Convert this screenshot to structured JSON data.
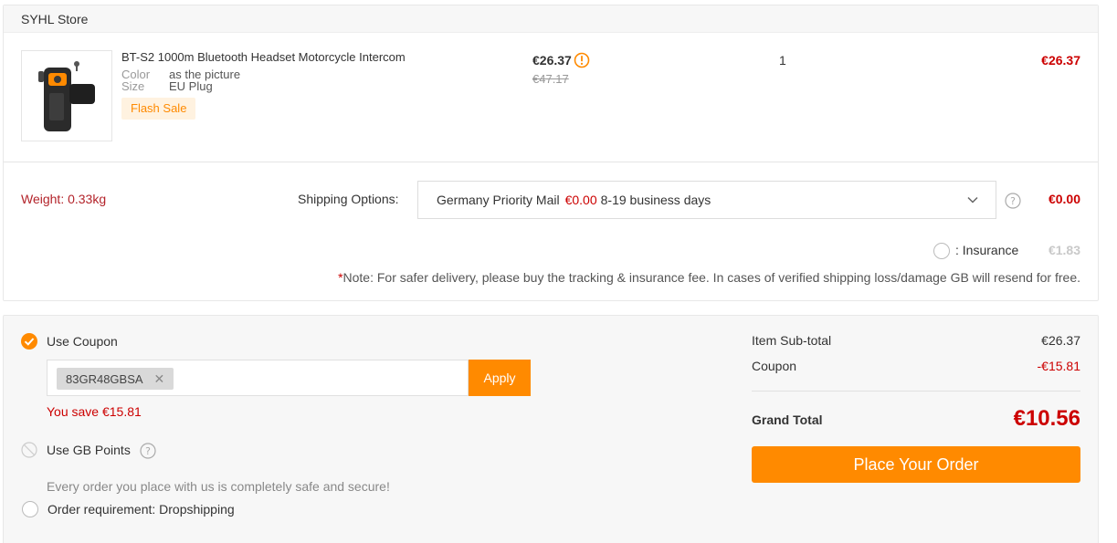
{
  "store": {
    "name": "SYHL Store"
  },
  "product": {
    "title": "BT-S2 1000m Bluetooth Headset Motorcycle Intercom",
    "color_label": "Color",
    "color_value": "as the picture",
    "size_label": "Size",
    "size_value": "EU Plug",
    "badge": "Flash Sale",
    "price": "€26.37",
    "original_price": "€47.17",
    "quantity": "1",
    "line_total": "€26.37"
  },
  "shipping": {
    "weight": "Weight: 0.33kg",
    "options_label": "Shipping Options:",
    "method": "Germany Priority Mail",
    "method_price": "€0.00",
    "method_time": "8-19 business days",
    "cost": "€0.00",
    "insurance_label": ": Insurance",
    "insurance_price": "€1.83",
    "note_star": "*",
    "note": "Note: For safer delivery, please buy the tracking & insurance fee. In cases of verified shipping loss/damage GB will resend for free."
  },
  "coupon": {
    "use_label": "Use Coupon",
    "code": "83GR48GBSA",
    "remove_symbol": "✕",
    "apply_label": "Apply",
    "savings": "You save €15.81"
  },
  "points": {
    "label": "Use GB Points"
  },
  "security_text": "Every order you place with us is completely safe and secure!",
  "dropshipping_label": "Order requirement: Dropshipping",
  "summary": {
    "subtotal_label": "Item Sub-total",
    "subtotal_value": "€26.37",
    "coupon_label": "Coupon",
    "coupon_value": "-€15.81",
    "grand_label": "Grand Total",
    "grand_value": "€10.56",
    "order_button": "Place Your Order"
  },
  "colors": {
    "accent": "#ff8a00",
    "price_red": "#cc0000",
    "badge_bg": "#fff2e0"
  },
  "icons": [
    "warning-icon",
    "chevron-down-icon",
    "help-icon",
    "check-circle-icon",
    "ban-icon",
    "close-icon"
  ]
}
